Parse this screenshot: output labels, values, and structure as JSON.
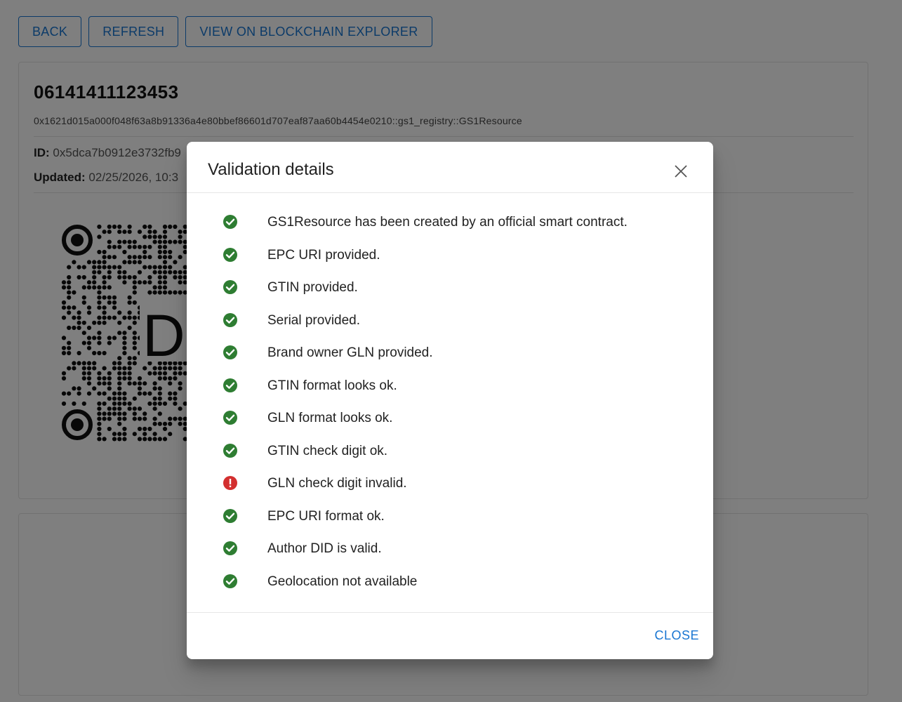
{
  "toolbar": {
    "back_label": "BACK",
    "refresh_label": "REFRESH",
    "explorer_label": "VIEW ON BLOCKCHAIN EXPLORER"
  },
  "resource": {
    "title": "06141411123453",
    "type": "0x1621d015a000f048f63a8b91336a4e80bbef86601d707eaf87aa60b4454e0210::gs1_registry::GS1Resource",
    "id_label": "ID:",
    "id_value": "0x5dca7b0912e3732fb9",
    "updated_label": "Updated:",
    "updated_value": "02/25/2026, 10:3",
    "qr_center_text": "DID"
  },
  "dialog": {
    "title": "Validation details",
    "close_label": "CLOSE",
    "items": [
      {
        "text": "GS1Resource has been created by an official smart contract.",
        "status": "ok"
      },
      {
        "text": "EPC URI provided.",
        "status": "ok"
      },
      {
        "text": "GTIN provided.",
        "status": "ok"
      },
      {
        "text": "Serial provided.",
        "status": "ok"
      },
      {
        "text": "Brand owner GLN provided.",
        "status": "ok"
      },
      {
        "text": "GTIN format looks ok.",
        "status": "ok"
      },
      {
        "text": "GLN format looks ok.",
        "status": "ok"
      },
      {
        "text": "GTIN check digit ok.",
        "status": "ok"
      },
      {
        "text": "GLN check digit invalid.",
        "status": "error"
      },
      {
        "text": "EPC URI format ok.",
        "status": "ok"
      },
      {
        "text": "Author DID is valid.",
        "status": "ok"
      },
      {
        "text": "Geolocation not available",
        "status": "ok"
      }
    ]
  },
  "colors": {
    "accent": "#1976d2",
    "success": "#2e7d32",
    "error": "#d32f2f"
  }
}
